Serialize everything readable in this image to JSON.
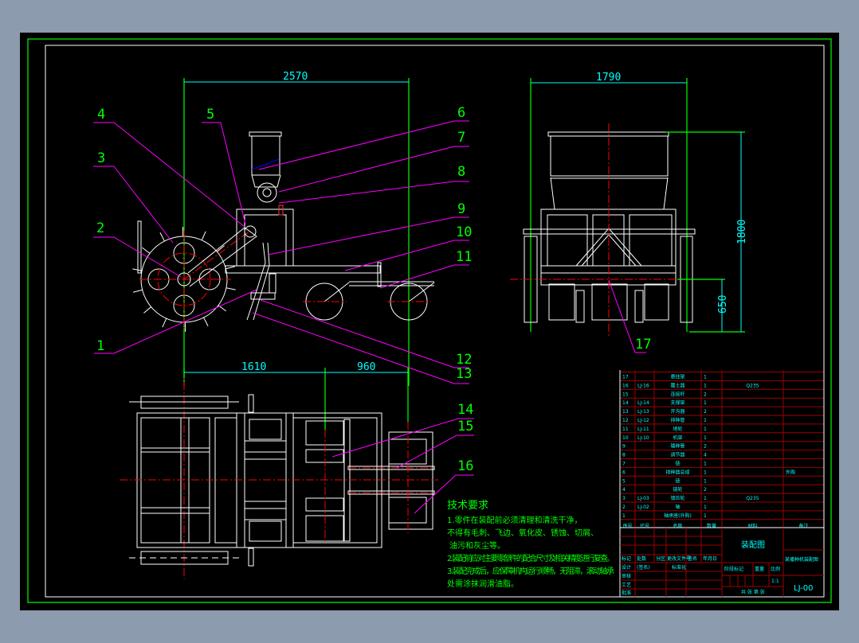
{
  "colors": {
    "background": "#8c9bae",
    "canvas": "#000000",
    "frame": "#00ff00",
    "geometry": "#ffffff",
    "center": "#ff0000",
    "dimension": "#00ffff",
    "leader": "#ff00ff",
    "title_block": "#a00000"
  },
  "dimensions": {
    "side_total": "2570",
    "front_width": "1790",
    "front_height": "1800",
    "front_ground": "650",
    "plan_front": "1610",
    "plan_rear": "960"
  },
  "part_labels": [
    "1",
    "2",
    "3",
    "4",
    "5",
    "6",
    "7",
    "8",
    "9",
    "10",
    "11",
    "12",
    "13",
    "14",
    "15",
    "16",
    "17"
  ],
  "requirements": {
    "title": "技术要求",
    "lines": [
      "1.零件在装配前必须清理和清洗干净，",
      "不得有毛刺、飞边、氧化皮、锈蚀、切屑、",
      "油污和灰尘等。",
      "2.装配前应对主要零部件的配合尺寸及相关精度进行复查。",
      "3.装配完成后，应保障机构运行顺畅，无阻滞，滚动轴承",
      "处需涂抹润滑油脂。"
    ]
  },
  "bom": {
    "headers": [
      "序号",
      "代号",
      "名称",
      "数量",
      "材料",
      "备注"
    ],
    "rows": [
      {
        "no": "17",
        "code": "",
        "name": "悬挂架",
        "qty": "1",
        "mat": "",
        "note": ""
      },
      {
        "no": "16",
        "code": "LJ-16",
        "name": "覆土器",
        "qty": "1",
        "mat": "Q235",
        "note": ""
      },
      {
        "no": "15",
        "code": "",
        "name": "连接杆",
        "qty": "2",
        "mat": "",
        "note": ""
      },
      {
        "no": "14",
        "code": "LJ-14",
        "name": "支撑架",
        "qty": "1",
        "mat": "",
        "note": ""
      },
      {
        "no": "13",
        "code": "LJ-13",
        "name": "开沟器",
        "qty": "2",
        "mat": "",
        "note": ""
      },
      {
        "no": "12",
        "code": "LJ-12",
        "name": "排种管",
        "qty": "1",
        "mat": "",
        "note": ""
      },
      {
        "no": "11",
        "code": "LJ-11",
        "name": "地轮",
        "qty": "1",
        "mat": "",
        "note": ""
      },
      {
        "no": "10",
        "code": "LJ-10",
        "name": "机架",
        "qty": "1",
        "mat": "",
        "note": ""
      },
      {
        "no": "9",
        "code": "",
        "name": "输种管",
        "qty": "2",
        "mat": "",
        "note": ""
      },
      {
        "no": "8",
        "code": "",
        "name": "调节器",
        "qty": "4",
        "mat": "",
        "note": ""
      },
      {
        "no": "7",
        "code": "",
        "name": "链",
        "qty": "1",
        "mat": "",
        "note": ""
      },
      {
        "no": "6",
        "code": "",
        "name": "排种器总成",
        "qty": "1",
        "mat": "",
        "note": "外购"
      },
      {
        "no": "5",
        "code": "",
        "name": "链",
        "qty": "1",
        "mat": "",
        "note": ""
      },
      {
        "no": "4",
        "code": "",
        "name": "链轮",
        "qty": "2",
        "mat": "",
        "note": ""
      },
      {
        "no": "3",
        "code": "LJ-03",
        "name": "镇压轮",
        "qty": "1",
        "mat": "Q235",
        "note": ""
      },
      {
        "no": "2",
        "code": "LJ-02",
        "name": "轴",
        "qty": "1",
        "mat": "",
        "note": ""
      },
      {
        "no": "1",
        "code": "",
        "name": "轴承座(外购)",
        "qty": "1",
        "mat": "",
        "note": ""
      }
    ]
  },
  "title_block": {
    "drawing_title": "装配图",
    "product": "某播种机装配图",
    "drawing_no": "LJ-00",
    "mark": "标记",
    "count": "处数",
    "zone": "分区",
    "change_doc": "更改文件号",
    "sign": "签名",
    "date": "年月日",
    "design": "设计",
    "standard": "标准化",
    "sign2": "(签名)",
    "check": "审核",
    "process": "工艺",
    "approve": "批准",
    "stage": "阶段标记",
    "weight": "重量",
    "scale": "比例",
    "scale_value": "1:1",
    "sheets": "共 张 第 张"
  }
}
